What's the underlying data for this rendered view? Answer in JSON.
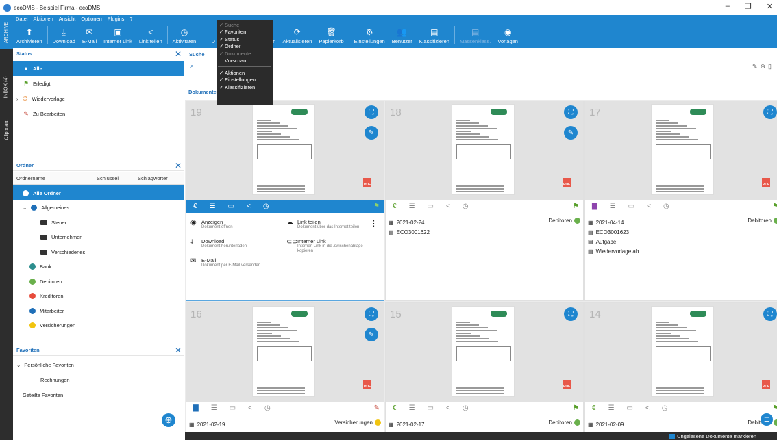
{
  "window": {
    "title": "ecoDMS - Beispiel Firma - ecoDMS",
    "controls": [
      "–",
      "❐",
      "✕"
    ]
  },
  "vtabs": [
    "ARCHIVE",
    "INBOX (4)",
    "Clipboard"
  ],
  "menubar": [
    "Datei",
    "Aktionen",
    "Ansicht",
    "Optionen",
    "Plugins",
    "?"
  ],
  "toolbar": [
    {
      "label": "Archivieren",
      "icon": "archive-icon",
      "glyph": "⬆"
    },
    {
      "label": "Download",
      "icon": "download-icon",
      "glyph": "⤓"
    },
    {
      "label": "E-Mail",
      "icon": "email-icon",
      "glyph": "✉"
    },
    {
      "label": "Interner Link",
      "icon": "internal-link-icon",
      "glyph": "▣"
    },
    {
      "label": "Link teilen",
      "icon": "share-icon",
      "glyph": "<"
    },
    {
      "label": "Aktivitäten",
      "icon": "activity-icon",
      "glyph": "◷"
    },
    {
      "label": "D",
      "icon": "other-icon",
      "glyph": ""
    },
    {
      "label": "etzen",
      "icon": "reset-icon",
      "glyph": ""
    },
    {
      "label": "Neu laden",
      "icon": "reload-icon",
      "glyph": "▤"
    },
    {
      "label": "Aktualisieren",
      "icon": "refresh-icon",
      "glyph": "⟳"
    },
    {
      "label": "Papierkorb",
      "icon": "trash-icon",
      "glyph": "🗑"
    },
    {
      "label": "Einstellungen",
      "icon": "settings-icon",
      "glyph": "⚙"
    },
    {
      "label": "Benutzer",
      "icon": "users-icon",
      "glyph": "👥"
    },
    {
      "label": "Klassifizieren",
      "icon": "classify-icon",
      "glyph": "▤"
    },
    {
      "label": "Massenklass.",
      "icon": "bulk-classify-icon",
      "glyph": "▤",
      "dim": true
    },
    {
      "label": "Vorlagen",
      "icon": "templates-icon",
      "glyph": "◉"
    }
  ],
  "view_menu": [
    {
      "label": "Suche",
      "checked": true,
      "dim": true
    },
    {
      "label": "Favoriten",
      "checked": true
    },
    {
      "label": "Status",
      "checked": true
    },
    {
      "label": "Ordner",
      "checked": true
    },
    {
      "label": "Dokumente",
      "checked": true,
      "dim": true
    },
    {
      "label": "Vorschau",
      "checked": false
    },
    {
      "label": "Aktionen",
      "checked": true
    },
    {
      "label": "Einstellungen",
      "checked": true
    },
    {
      "label": "Klassifizieren",
      "checked": true
    }
  ],
  "status": {
    "title": "Status",
    "items": [
      {
        "label": "Alle",
        "selected": true,
        "color": "#333333"
      },
      {
        "label": "Erledigt",
        "color": "#5aa02c"
      },
      {
        "label": "Wiedervorlage",
        "color": "#e67e22"
      },
      {
        "label": "Zu Bearbeiten",
        "color": "#c0392b"
      }
    ]
  },
  "ordner": {
    "title": "Ordner",
    "cols": [
      "Ordnername",
      "Schlüssel",
      "Schlagwörter"
    ],
    "items": [
      {
        "label": "Alle Ordner",
        "level": 0,
        "selected": true
      },
      {
        "label": "Allgemeines",
        "level": 1,
        "color": "#1f6fb8"
      },
      {
        "label": "Steuer",
        "level": 2
      },
      {
        "label": "Unternehmen",
        "level": 2
      },
      {
        "label": "Verschiedenes",
        "level": 2
      },
      {
        "label": "Bank",
        "level": 1,
        "color": "#2d8e8e"
      },
      {
        "label": "Debitoren",
        "level": 1,
        "color": "#6ab04c"
      },
      {
        "label": "Kreditoren",
        "level": 1,
        "color": "#e74c3c"
      },
      {
        "label": "Mitarbeiter",
        "level": 1,
        "color": "#1f6fb8"
      },
      {
        "label": "Versicherungen",
        "level": 1,
        "color": "#f1c40f"
      }
    ]
  },
  "favoriten": {
    "title": "Favoriten",
    "items": [
      "Persönliche Favoriten",
      "Rechnungen",
      "Geteilte Favoriten"
    ]
  },
  "main": {
    "search_title": "Suche",
    "docs_title": "Dokumente",
    "unread_label": "Ungelesene Dokumente markieren"
  },
  "cards": [
    {
      "num": "19",
      "selected": true
    },
    {
      "num": "18",
      "date": "2021-02-24",
      "folder": "Debitoren",
      "id": "ECO3001622"
    },
    {
      "num": "17",
      "date": "2021-04-14",
      "folder": "Debitoren",
      "id": "ECO3001623",
      "extra": [
        "Aufgabe",
        "Wiedervorlage ab"
      ]
    },
    {
      "num": "16",
      "date": "2021-02-19",
      "folder": "Versicherungen"
    },
    {
      "num": "15",
      "date": "2021-02-17",
      "folder": "Debitoren"
    },
    {
      "num": "14",
      "date": "2021-02-09",
      "folder": "Debitoren"
    }
  ],
  "actions": [
    {
      "label": "Anzeigen",
      "desc": "Dokument öffnen",
      "glyph": "◉"
    },
    {
      "label": "Link teilen",
      "desc": "Dokument über das Internet teilen",
      "glyph": "☁"
    },
    {
      "label": "Download",
      "desc": "Dokument herunterladen",
      "glyph": "⤓"
    },
    {
      "label": "Interner Link",
      "desc": "Internen Link in die Zwischenablage kopieren",
      "glyph": "⊂⊃"
    },
    {
      "label": "E-Mail",
      "desc": "Dokument per E-Mail versenden",
      "glyph": "✉"
    }
  ],
  "pdf_label": "PDF"
}
